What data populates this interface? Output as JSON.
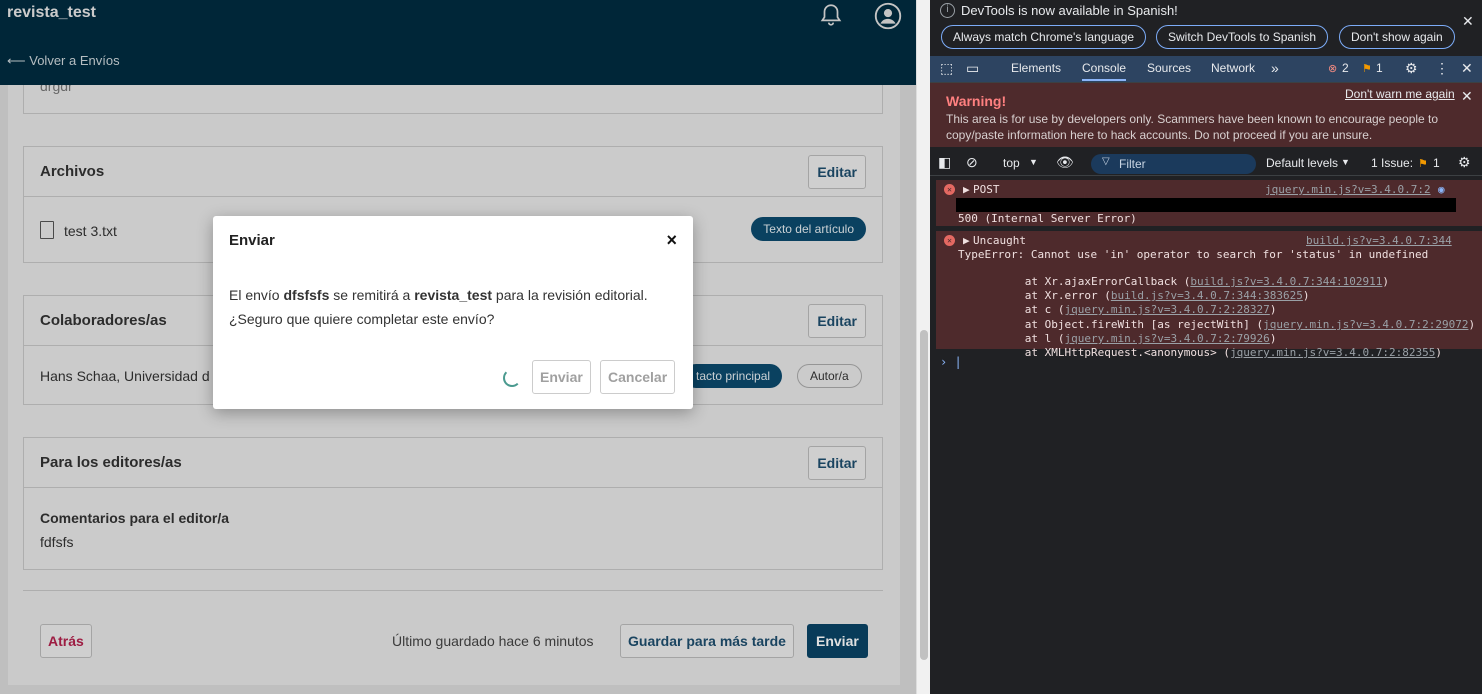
{
  "app": {
    "brand": "revista_test",
    "back_link": "⟵ Volver a Envíos",
    "partial_text": "drgdr",
    "files_card": {
      "title": "Archivos",
      "edit_label": "Editar",
      "file_name": "test 3.txt",
      "file_tag": "Texto del artículo"
    },
    "contributors_card": {
      "title": "Colaboradores/as",
      "edit_label": "Editar",
      "person": "Hans Schaa, Universidad d",
      "role_primary": "tacto principal",
      "role": "Autor/a"
    },
    "editors_card": {
      "title": "Para los editores/as",
      "edit_label": "Editar",
      "comment_label": "Comentarios para el editor/a",
      "comment_value": "fdfsfs"
    },
    "footer": {
      "back_label": "Atrás",
      "saved_text": "Último guardado hace 6 minutos",
      "save_later_label": "Guardar para más tarde",
      "submit_label": "Enviar"
    }
  },
  "modal": {
    "title": "Enviar",
    "close": "×",
    "text_pre": "El envío ",
    "submission": "dfsfsfs",
    "text_mid": " se remitirá a ",
    "journal": "revista_test",
    "text_post": " para la revisión editorial.",
    "question": "¿Seguro que quiere completar este envío?",
    "submit_label": "Enviar",
    "cancel_label": "Cancelar"
  },
  "devtools": {
    "banner": {
      "text": "DevTools is now available in Spanish!",
      "btn1": "Always match Chrome's language",
      "btn2": "Switch DevTools to Spanish",
      "btn3": "Don't show again"
    },
    "tabs": [
      "Elements",
      "Console",
      "Sources",
      "Network"
    ],
    "active_tab": "Console",
    "error_count": "2",
    "issue_count": "1",
    "warning": {
      "title": "Warning!",
      "link": "Don't warn me again",
      "text": "This area is for use by developers only. Scammers have been known to encourage people to copy/paste information here to hack accounts. Do not proceed if you are unsure."
    },
    "console_bar": {
      "context": "top",
      "filter": "Filter",
      "levels": "Default levels",
      "issues": "1 Issue:",
      "issues_count": "1"
    },
    "errors": {
      "post": {
        "head": "POST",
        "source": "jquery.min.js?v=3.4.0.7:2",
        "status": "500 (Internal Server Error)"
      },
      "uncaught": {
        "head": "Uncaught",
        "source": "build.js?v=3.4.0.7:344",
        "message": "TypeError: Cannot use 'in' operator to search for 'status' in undefined",
        "stack": [
          {
            "fn": "at Xr.ajaxErrorCallback (",
            "src": "build.js?v=3.4.0.7:344:102911",
            "end": ")"
          },
          {
            "fn": "at Xr.error (",
            "src": "build.js?v=3.4.0.7:344:383625",
            "end": ")"
          },
          {
            "fn": "at c (",
            "src": "jquery.min.js?v=3.4.0.7:2:28327",
            "end": ")"
          },
          {
            "fn": "at Object.fireWith [as rejectWith] (",
            "src": "jquery.min.js?v=3.4.0.7:2:29072",
            "end": ")"
          },
          {
            "fn": "at l (",
            "src": "jquery.min.js?v=3.4.0.7:2:79926",
            "end": ")"
          },
          {
            "fn": "at XMLHttpRequest.<anonymous> (",
            "src": "jquery.min.js?v=3.4.0.7:2:82355",
            "end": ")"
          }
        ]
      }
    }
  }
}
